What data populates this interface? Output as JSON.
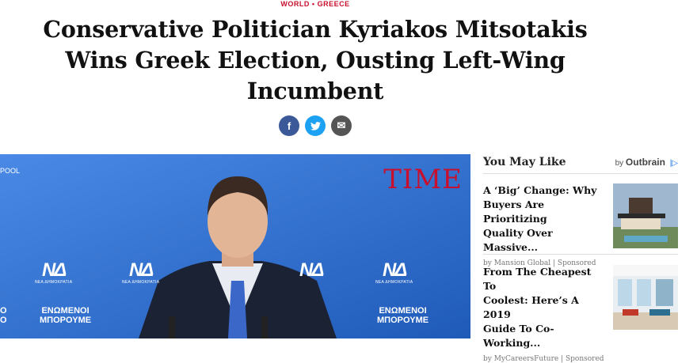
{
  "section": {
    "primary": "WORLD",
    "separator": "•",
    "secondary": "GREECE"
  },
  "headline": {
    "line1": "Conservative Politician Kyriakos Mitsotakis",
    "line2": "Wins Greek Election, Ousting Left-Wing",
    "line3": "Incumbent"
  },
  "share": {
    "facebook": "f",
    "twitter": "t",
    "email": "✉"
  },
  "photo": {
    "caption_fragment": "POOL",
    "watermark": "TIME",
    "party_logo_mark": "ΝΔ",
    "party_logo_text": "ΝΕΑ ΔΗΜΟΚΡΑΤΙΑ",
    "slogan_line1": "ΕΝΩΜΕΝΟΙ",
    "slogan_line2": "ΜΠΟΡΟΥΜΕ",
    "edge_left_top": "Ο",
    "edge_left_bottom": "Ο",
    "colors": {
      "background": "#2f6fd0",
      "watermark": "#c8102e"
    }
  },
  "sidebar": {
    "title": "You May Like",
    "by": "by",
    "brand": "Outbrain",
    "ad_marker": "|▷",
    "items": [
      {
        "title_line1": "A ‘Big’ Change: Why",
        "title_line2": "Buyers Are Prioritizing",
        "title_line3": "Quality Over Massive...",
        "source": "by Mansion Global | Sponsored",
        "thumb_icon": "modern-house-image"
      },
      {
        "title_line1": "From The Cheapest To",
        "title_line2": "Coolest: Here’s A 2019",
        "title_line3": "Guide To Co-Working...",
        "source": "by MyCareersFuture | Sponsored",
        "thumb_icon": "coworking-office-image"
      }
    ]
  },
  "colors": {
    "accent": "#c8102e",
    "facebook": "#3b5998",
    "twitter": "#1da1f2"
  }
}
